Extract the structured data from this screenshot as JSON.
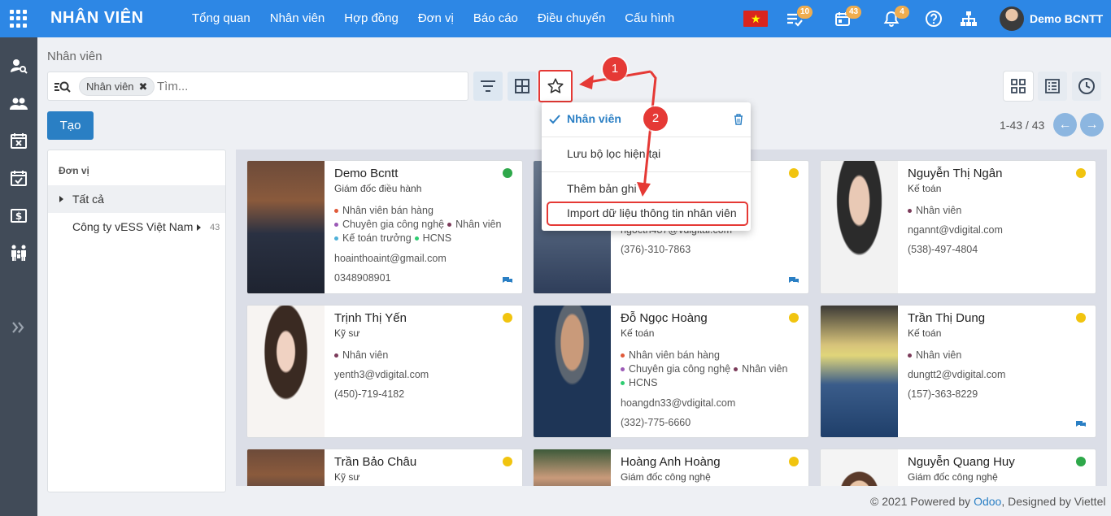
{
  "topbar": {
    "brand": "NHÂN VIÊN",
    "menu": [
      "Tổng quan",
      "Nhân viên",
      "Hợp đồng",
      "Đơn vị",
      "Báo cáo",
      "Điều chuyển",
      "Cấu hình"
    ],
    "badges": {
      "activities": "10",
      "calendar": "43",
      "notifications": "4"
    },
    "user": "Demo BCNTT",
    "language": "vi-flag-icon"
  },
  "sidebar": [
    "user-search-icon",
    "users-icon",
    "calendar-x-icon",
    "calendar-check-icon",
    "salary-icon",
    "family-icon",
    "expand-icon"
  ],
  "breadcrumb": "Nhân viên",
  "search": {
    "facet": "Nhân viên",
    "placeholder": "Tìm..."
  },
  "create_label": "Tạo",
  "pager": "1-43 / 43",
  "panel": {
    "title": "Đơn vị",
    "all": "Tất cả",
    "company": "Công ty vESS Việt Nam",
    "count": "43"
  },
  "favorites": {
    "items": [
      "Nhân viên",
      "Lưu bộ lọc hiện tại",
      "Thêm bản ghi",
      "Import dữ liệu thông tin nhân viên"
    ],
    "selected": "Nhân viên"
  },
  "annotations": [
    "1",
    "2"
  ],
  "employees": [
    {
      "name": "Demo Bcntt",
      "job": "Giám đốc điều hành",
      "status": "#2ea84a",
      "tags": [
        {
          "t": "Nhân viên bán hàng",
          "c": "#e05a3a"
        },
        {
          "t": "Chuyên gia công nghệ",
          "c": "#9b59b6"
        },
        {
          "t": "Nhân viên",
          "c": "#7b3b5a"
        },
        {
          "t": "Kế toán trưởng",
          "c": "#4fb0d8"
        },
        {
          "t": "HCNS",
          "c": "#2ecc71"
        }
      ],
      "email": "hoainthoaint@gmail.com",
      "phone": "0348908901"
    },
    {
      "name": "",
      "job": "",
      "status": "#f1c40f",
      "tags": [],
      "email": "ngoctn487@vdigital.com",
      "phone": "(376)-310-7863"
    },
    {
      "name": "Nguyễn Thị Ngân",
      "job": "Kế toán",
      "status": "#f1c40f",
      "tags": [
        {
          "t": "Nhân viên",
          "c": "#7b3b5a"
        }
      ],
      "email": "ngannt@vdigital.com",
      "phone": "(538)-497-4804"
    },
    {
      "name": "Trịnh Thị Yến",
      "job": "Kỹ sư",
      "status": "#f1c40f",
      "tags": [
        {
          "t": "Nhân viên",
          "c": "#7b3b5a"
        }
      ],
      "email": "yenth3@vdigital.com",
      "phone": "(450)-719-4182"
    },
    {
      "name": "Đỗ Ngọc Hoàng",
      "job": "Kế toán",
      "status": "#f1c40f",
      "tags": [
        {
          "t": "Nhân viên bán hàng",
          "c": "#e05a3a"
        },
        {
          "t": "Chuyên gia công nghệ",
          "c": "#9b59b6"
        },
        {
          "t": "Nhân viên",
          "c": "#7b3b5a"
        },
        {
          "t": "HCNS",
          "c": "#2ecc71"
        }
      ],
      "email": "hoangdn33@vdigital.com",
      "phone": "(332)-775-6660"
    },
    {
      "name": "Trần Thị Dung",
      "job": "Kế toán",
      "status": "#f1c40f",
      "tags": [
        {
          "t": "Nhân viên",
          "c": "#7b3b5a"
        }
      ],
      "email": "dungtt2@vdigital.com",
      "phone": "(157)-363-8229"
    },
    {
      "name": "Trần Bảo Châu",
      "job": "Kỹ sư",
      "status": "#f1c40f",
      "tags": [],
      "email": "",
      "phone": ""
    },
    {
      "name": "Hoàng Anh Hoàng",
      "job": "Giám đốc công nghệ",
      "status": "#f1c40f",
      "tags": [],
      "email": "",
      "phone": ""
    },
    {
      "name": "Nguyễn Quang Huy",
      "job": "Giám đốc công nghệ",
      "status": "#2ea84a",
      "tags": [],
      "email": "",
      "phone": ""
    }
  ],
  "footer": {
    "prefix": "© 2021 Powered by ",
    "odoo": "Odoo",
    "suffix": ", Designed by Viettel"
  }
}
